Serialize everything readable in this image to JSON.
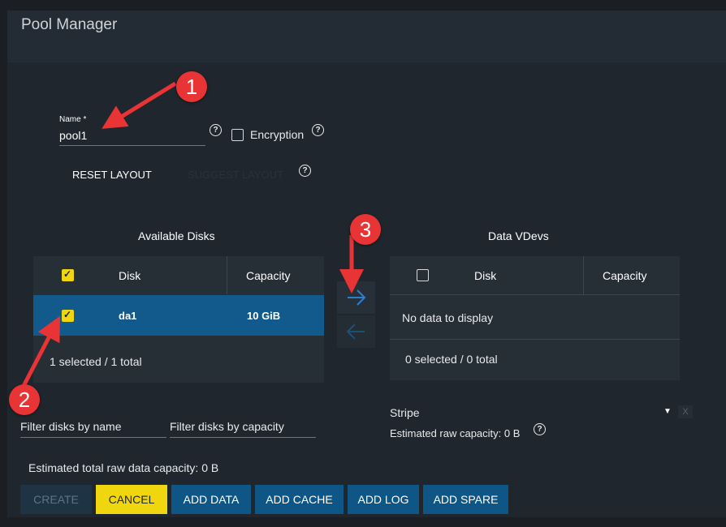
{
  "dialog": {
    "title": "Pool Manager"
  },
  "form": {
    "name_label": "Name *",
    "name_value": "pool1",
    "encryption_label": "Encryption",
    "reset_layout_label": "RESET LAYOUT",
    "suggest_layout_label": "SUGGEST LAYOUT"
  },
  "available": {
    "title": "Available Disks",
    "col_disk": "Disk",
    "col_capacity": "Capacity",
    "rows": [
      {
        "disk": "da1",
        "capacity": "10 GiB",
        "selected": true
      }
    ],
    "footer": "1 selected / 1 total",
    "filter_name_placeholder": "Filter disks by name",
    "filter_capacity_placeholder": "Filter disks by capacity"
  },
  "vdevs": {
    "title": "Data VDevs",
    "col_disk": "Disk",
    "col_capacity": "Capacity",
    "empty_text": "No data to display",
    "footer": "0 selected / 0 total",
    "layout_value": "Stripe",
    "remove_label": "X",
    "est_raw_capacity": "Estimated raw capacity: 0 B"
  },
  "estimated_total": "Estimated total raw data capacity: 0 B",
  "buttons": {
    "create": "CREATE",
    "cancel": "CANCEL",
    "add_data": "ADD DATA",
    "add_cache": "ADD CACHE",
    "add_log": "ADD LOG",
    "add_spare": "ADD SPARE"
  },
  "annotations": {
    "one": "1",
    "two": "2",
    "three": "3"
  },
  "colors": {
    "accent_blue": "#0d5686",
    "selected_row": "#125a8c",
    "cancel_yellow": "#f0d60e",
    "annotation_red": "#e83434"
  },
  "icons": [
    "help-icon",
    "arrow-right-icon",
    "arrow-left-icon",
    "dropdown-caret-icon"
  ]
}
